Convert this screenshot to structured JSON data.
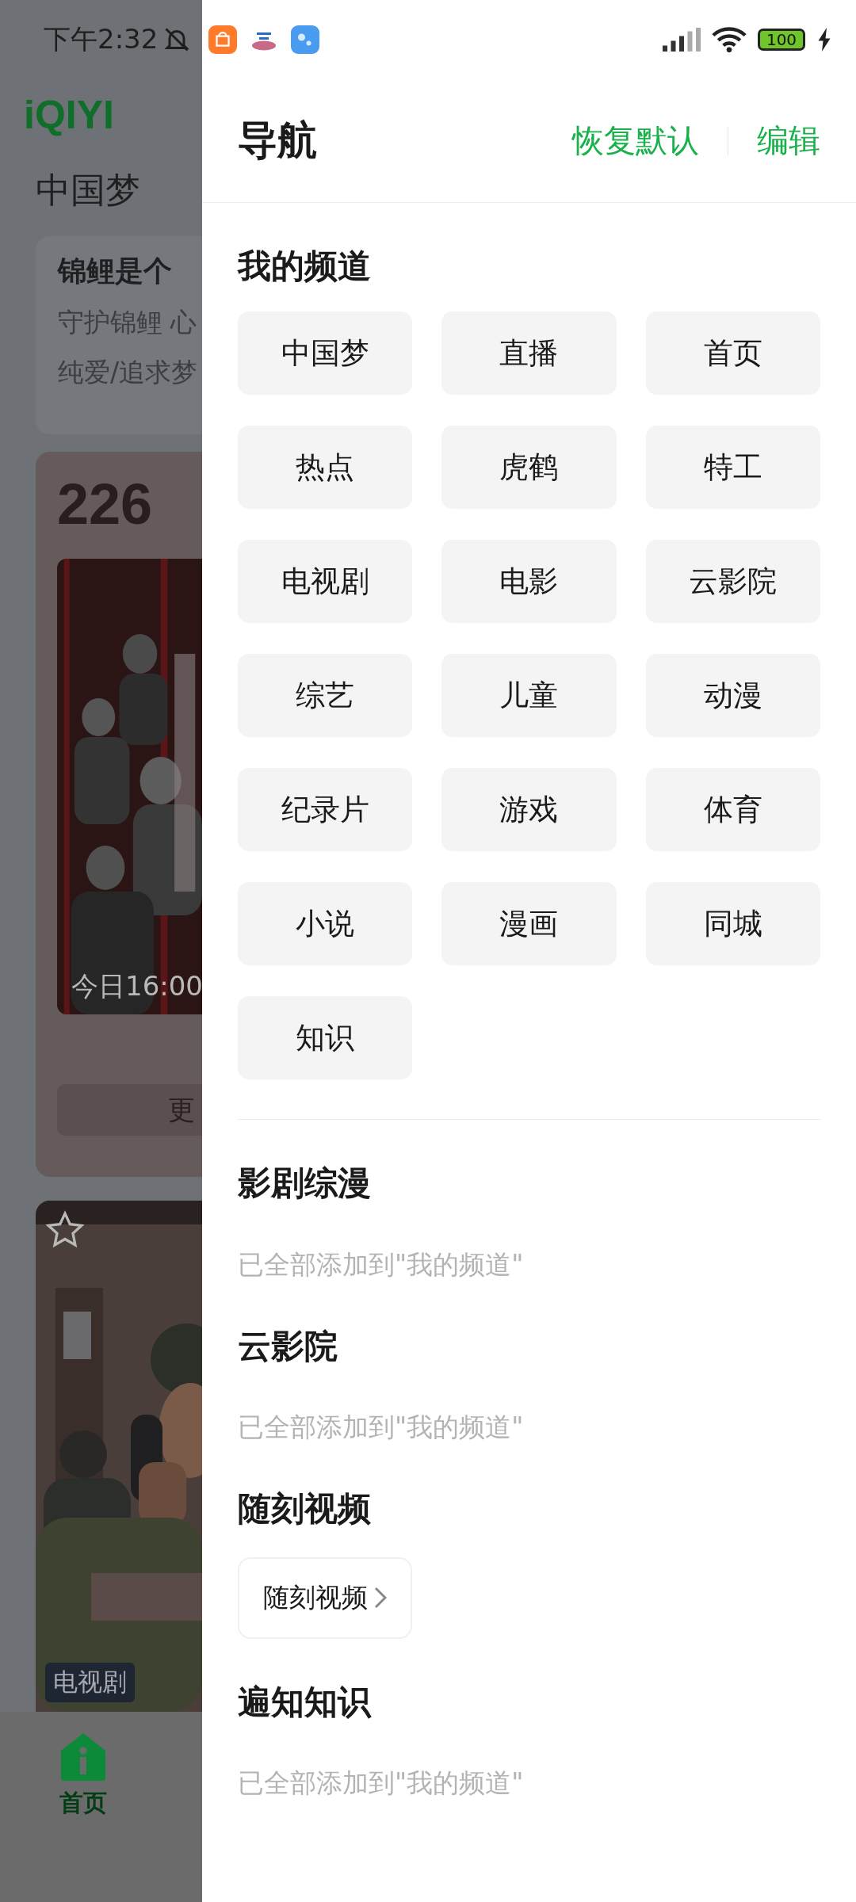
{
  "status_bar": {
    "time": "下午2:32",
    "battery": "100"
  },
  "background_app": {
    "logo": "iQIYI",
    "tabs": [
      "中国梦"
    ],
    "card": {
      "title": "锦鲤是个",
      "subtitle": "守护锦鲤 心",
      "tags": "纯爱/追求梦"
    },
    "ranking": {
      "count": "226",
      "poster_caption": "今日16:00",
      "button": "更"
    },
    "poster": {
      "badge": "电视剧"
    },
    "bottom_nav": [
      {
        "label": "首页",
        "selected": true
      }
    ]
  },
  "drawer": {
    "title": "导航",
    "actions": [
      {
        "label": "恢复默认"
      },
      {
        "label": "编辑"
      }
    ],
    "my_channels": {
      "title": "我的频道",
      "items": [
        "中国梦",
        "直播",
        "首页",
        "热点",
        "虎鹤",
        "特工",
        "电视剧",
        "电影",
        "云影院",
        "综艺",
        "儿童",
        "动漫",
        "纪录片",
        "游戏",
        "体育",
        "小说",
        "漫画",
        "同城",
        "知识"
      ]
    },
    "sections": [
      {
        "kind": "note",
        "title": "影剧综漫",
        "note": "已全部添加到\"我的频道\""
      },
      {
        "kind": "note",
        "title": "云影院",
        "note": "已全部添加到\"我的频道\""
      },
      {
        "kind": "chips",
        "title": "随刻视频",
        "chips": [
          "随刻视频"
        ]
      },
      {
        "kind": "note",
        "title": "遍知知识",
        "note": "已全部添加到\"我的频道\""
      }
    ]
  }
}
